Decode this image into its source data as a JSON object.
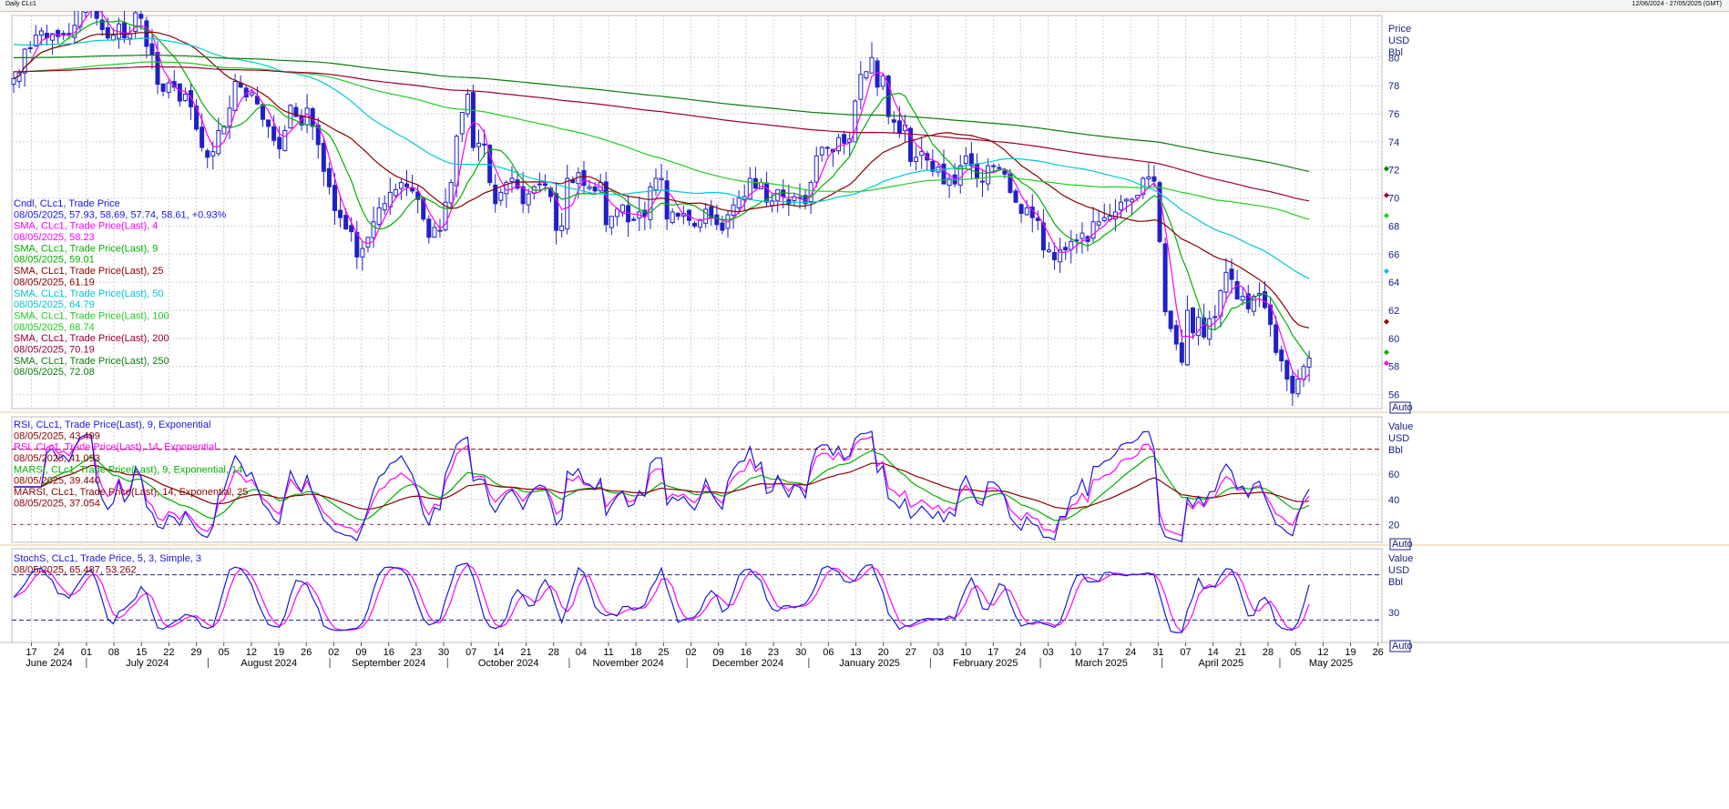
{
  "window": {
    "title": "Daily CLc1",
    "range_text": "12/06/2024 - 27/05/2025 (GMT)"
  },
  "price_panel": {
    "axis_unit": [
      "Price",
      "USD",
      "Bbl"
    ],
    "auto_label": "Auto",
    "ticks": [
      56,
      58,
      60,
      62,
      64,
      66,
      68,
      70,
      72,
      74,
      76,
      78,
      80
    ],
    "legend": [
      {
        "title": "Cndl, CLc1, Trade Price",
        "value": "08/05/2025, 57.93, 58.69, 57.74, 58.61, +0.93%",
        "color": "#1a1adc"
      },
      {
        "title": "SMA, CLc1, Trade Price(Last),  4",
        "value": "08/05/2025, 58.23",
        "color": "#ff00ff"
      },
      {
        "title": "SMA, CLc1, Trade Price(Last),  9",
        "value": "08/05/2025, 59.01",
        "color": "#00b000"
      },
      {
        "title": "SMA, CLc1, Trade Price(Last),  25",
        "value": "08/05/2025, 61.19",
        "color": "#8b0000"
      },
      {
        "title": "SMA, CLc1, Trade Price(Last),  50",
        "value": "08/05/2025, 64.79",
        "color": "#00c8d2"
      },
      {
        "title": "SMA, CLc1, Trade Price(Last),  100",
        "value": "08/05/2025, 68.74",
        "color": "#22cc22"
      },
      {
        "title": "SMA, CLc1, Trade Price(Last),  200",
        "value": "08/05/2025, 70.19",
        "color": "#9b0030"
      },
      {
        "title": "SMA, CLc1, Trade Price(Last),  250",
        "value": "08/05/2025, 72.08",
        "color": "#0b7d0b"
      }
    ]
  },
  "rsi_panel": {
    "axis_unit": [
      "Value",
      "USD",
      "Bbl"
    ],
    "auto_label": "Auto",
    "ticks": [
      20,
      40,
      60
    ],
    "levels": [
      20,
      80
    ],
    "legend": [
      {
        "title": "RSI, CLc1, Trade Price(Last),  9, Exponential",
        "value": "08/05/2025, 43.499",
        "color": "#1a1adc"
      },
      {
        "title": "RSI, CLc1, Trade Price(Last),  14, Exponential",
        "value": "08/05/2025, 41.093",
        "color": "#ff00ff"
      },
      {
        "title": "MARSI, CLc1, Trade Price(Last),  9, Exponential, 14",
        "value": "08/05/2025, 39.440",
        "color": "#00b000"
      },
      {
        "title": "MARSI, CLc1, Trade Price(Last),  14, Exponential, 25",
        "value": "08/05/2025, 37.054",
        "color": "#8b0000"
      }
    ]
  },
  "stoch_panel": {
    "axis_unit": [
      "Value",
      "USD",
      "Bbl"
    ],
    "auto_label": "Auto",
    "ticks": [
      30
    ],
    "levels": [
      20,
      80
    ],
    "legend": [
      {
        "title": "StochS, CLc1, Trade Price,  5, 3, Simple, 3",
        "value": "08/05/2025, 65.487, 53.262",
        "color": "#1a1adc"
      }
    ]
  },
  "x_axis": {
    "day_ticks": [
      "17",
      "24",
      "01",
      "08",
      "15",
      "22",
      "29",
      "05",
      "12",
      "19",
      "26",
      "02",
      "09",
      "16",
      "23",
      "30",
      "07",
      "14",
      "21",
      "28",
      "04",
      "11",
      "18",
      "25",
      "02",
      "09",
      "16",
      "23",
      "30",
      "06",
      "13",
      "20",
      "27",
      "03",
      "10",
      "17",
      "24",
      "03",
      "10",
      "17",
      "24",
      "31",
      "07",
      "14",
      "21",
      "28",
      "05",
      "12",
      "19",
      "26"
    ],
    "months": [
      "June 2024",
      "July 2024",
      "August 2024",
      "September 2024",
      "October 2024",
      "November 2024",
      "December 2024",
      "January 2025",
      "February 2025",
      "March 2025",
      "April 2025",
      "May 2025"
    ]
  },
  "chart_data": {
    "type": "candlestick",
    "x_range": [
      "2024-06-12",
      "2025-05-27"
    ],
    "ylim": [
      55,
      83
    ],
    "last_bar": {
      "date": "08/05/2025",
      "open": 57.93,
      "high": 58.69,
      "low": 57.74,
      "close": 58.61,
      "change_pct": 0.93
    },
    "closes": [
      78.5,
      78.9,
      80.6,
      80.7,
      81.6,
      81.9,
      81.4,
      81.7,
      81.5,
      81.7,
      81.6,
      82.3,
      83.4,
      83.9,
      83.9,
      82.8,
      82.0,
      81.4,
      81.6,
      82.4,
      81.4,
      81.7,
      83.2,
      82.8,
      80.8,
      80.2,
      78.1,
      77.6,
      78.2,
      77.9,
      76.9,
      77.4,
      76.5,
      74.9,
      73.6,
      72.9,
      73.3,
      74.8,
      75.1,
      76.4,
      78.3,
      77.9,
      77.2,
      77.5,
      76.7,
      75.6,
      75.1,
      74.1,
      73.5,
      74.8,
      76.6,
      75.8,
      75.2,
      76.4,
      75.1,
      73.8,
      71.9,
      70.8,
      69.1,
      68.6,
      67.8,
      67.6,
      65.8,
      66.4,
      67.2,
      68.3,
      69.3,
      69.6,
      70.4,
      70.6,
      71.1,
      70.8,
      70.5,
      69.9,
      68.5,
      67.2,
      67.9,
      67.7,
      69.7,
      71.1,
      74.4,
      76.1,
      77.4,
      73.6,
      73.9,
      73.8,
      71.1,
      69.6,
      70.4,
      71.1,
      71.4,
      70.7,
      69.6,
      70.3,
      70.8,
      71.0,
      70.9,
      70.1,
      67.7,
      68.0,
      71.4,
      71.1,
      71.8,
      70.9,
      70.8,
      70.5,
      71.1,
      68.1,
      68.7,
      69.2,
      69.5,
      68.3,
      68.4,
      69.0,
      68.7,
      70.8,
      71.4,
      71.4,
      68.5,
      69.0,
      68.7,
      68.9,
      68.4,
      68.0,
      68.4,
      69.2,
      68.6,
      68.1,
      67.7,
      68.8,
      69.5,
      70.0,
      70.1,
      71.4,
      70.7,
      71.1,
      69.7,
      69.8,
      70.6,
      70.1,
      69.6,
      70.1,
      70.0,
      69.6,
      71.1,
      73.0,
      73.6,
      73.6,
      73.3,
      74.3,
      73.9,
      74.2,
      76.9,
      78.8,
      79.0,
      80.0,
      77.9,
      78.7,
      75.8,
      75.4,
      74.6,
      75.2,
      72.6,
      72.9,
      73.3,
      72.7,
      71.9,
      72.2,
      71.0,
      71.4,
      71.0,
      72.3,
      73.0,
      72.3,
      71.4,
      71.2,
      72.3,
      72.3,
      72.1,
      71.7,
      70.4,
      69.7,
      68.9,
      69.3,
      68.6,
      68.4,
      66.3,
      66.3,
      65.6,
      66.3,
      66.3,
      66.9,
      67.0,
      67.5,
      66.9,
      68.3,
      68.3,
      68.6,
      68.7,
      69.0,
      69.7,
      69.9,
      69.9,
      70.2,
      71.4,
      71.5,
      71.2,
      66.9,
      61.9,
      60.7,
      59.6,
      58.3,
      62.0,
      60.4,
      61.5,
      60.1,
      61.4,
      61.5,
      63.4,
      64.7,
      64.2,
      62.8,
      63.0,
      62.1,
      63.0,
      63.2,
      62.2,
      61.0,
      59.0,
      58.4,
      57.1,
      56.1,
      57.1,
      58.0,
      58.6
    ]
  }
}
